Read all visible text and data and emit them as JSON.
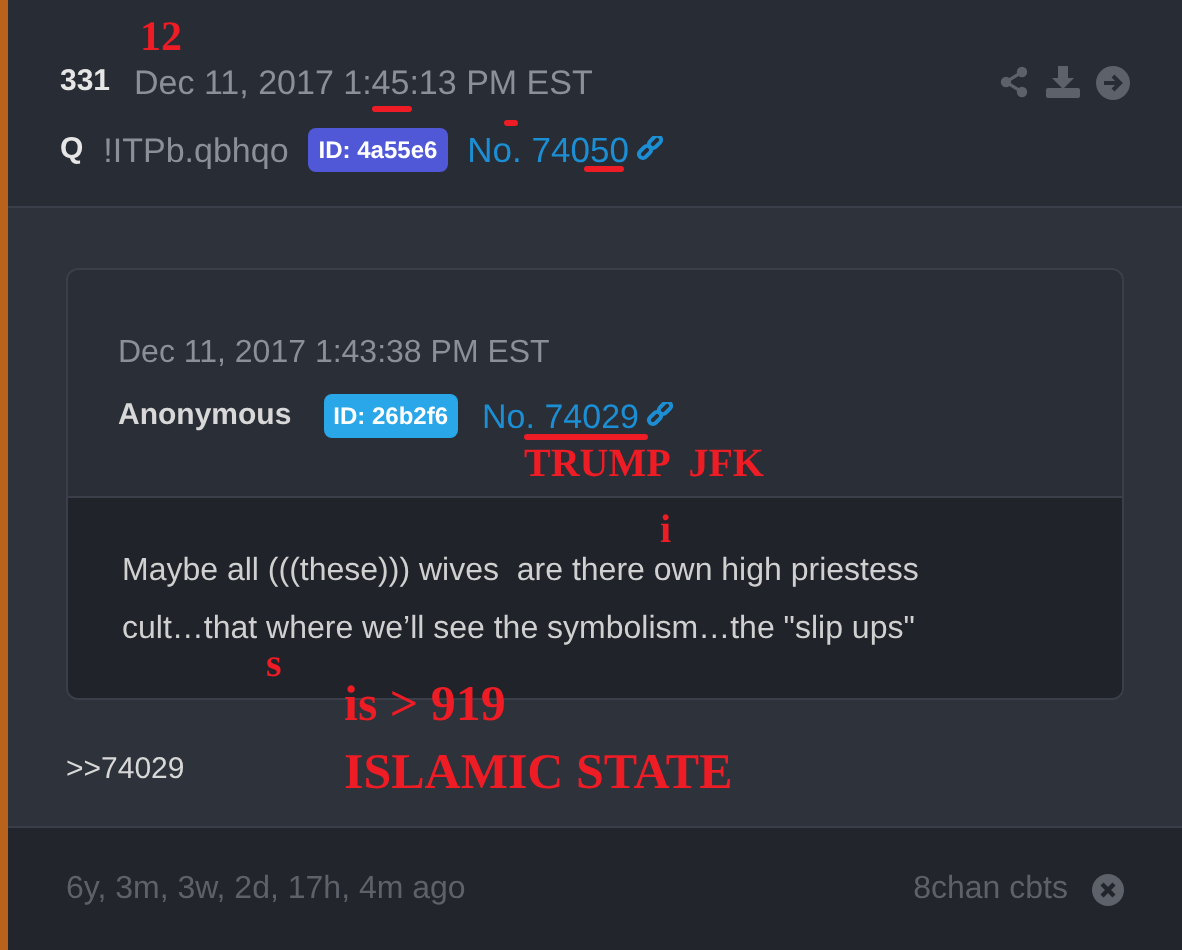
{
  "post": {
    "number": "331",
    "timestamp": "Dec 11, 2017 1:45:13 PM EST",
    "author": "Q",
    "tripcode": "!ITPb.qbhqo",
    "id_badge": "ID: 4a55e6",
    "post_no": "No. 74050",
    "reply_link": ">>74029"
  },
  "quoted_post": {
    "timestamp": "Dec 11, 2017 1:43:38 PM EST",
    "author": "Anonymous",
    "id_badge": "ID: 26b2f6",
    "post_no": "No. 74029",
    "text": "Maybe all (((these))) wives  are there own high priestess cult…that where we’ll see the symbolism…the \"slip ups\""
  },
  "footer": {
    "age": "6y, 3m, 3w, 2d, 17h, 4m ago",
    "source": "8chan cbts"
  },
  "annotations": [
    {
      "text": "12"
    },
    {
      "text": "TRUMP  JFK"
    },
    {
      "text": "i"
    },
    {
      "text": "s"
    },
    {
      "text": "is > 919"
    },
    {
      "text": "ISLAMIC STATE"
    }
  ]
}
